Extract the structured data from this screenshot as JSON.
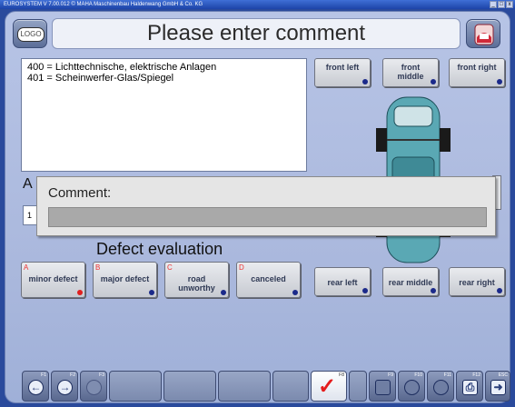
{
  "window": {
    "title": "EUROSYSTEM V 7.00.012 © MAHA Maschinenbau Haldenwang GmbH & Co. KG",
    "min": "_",
    "max": "□",
    "close": "x"
  },
  "header": {
    "logo_label": "LOGO",
    "title": "Please enter comment"
  },
  "defect_codes": [
    "400 = Lichttechnische, elektrische Anlagen",
    "401 = Scheinwerfer-Glas/Spiegel"
  ],
  "position_buttons": {
    "front_left": "front left",
    "front_middle": "front middle",
    "front_right": "front right",
    "rear_left": "rear left",
    "rear_middle": "rear middle",
    "rear_right": "rear right"
  },
  "hidden_label_fragment": "A",
  "hidden_input_fragment": "1",
  "comment_dialog": {
    "label": "Comment:",
    "value": ""
  },
  "defect_evaluation": {
    "title": "Defect evaluation",
    "options": [
      {
        "letter": "A",
        "label": "minor defect"
      },
      {
        "letter": "B",
        "label": "major defect"
      },
      {
        "letter": "C",
        "label": "road unworthy"
      },
      {
        "letter": "D",
        "label": "canceled"
      }
    ]
  },
  "toolbar": {
    "f1": "F1",
    "f2": "F2",
    "f3": "F3",
    "f8": "F8",
    "f9": "F9",
    "f10": "F10",
    "f11": "F11",
    "f12": "F12",
    "esc": "ESC"
  },
  "colors": {
    "background": "#2a4a9c",
    "panel": "#b7c4e6",
    "accent_red": "#e02020",
    "dot_blue": "#1b2a8a"
  },
  "icons": [
    "logo-icon",
    "help-icon",
    "back-arrow-icon",
    "forward-arrow-icon",
    "car-top-view-icon",
    "checkmark-icon",
    "print-icon",
    "exit-icon"
  ]
}
